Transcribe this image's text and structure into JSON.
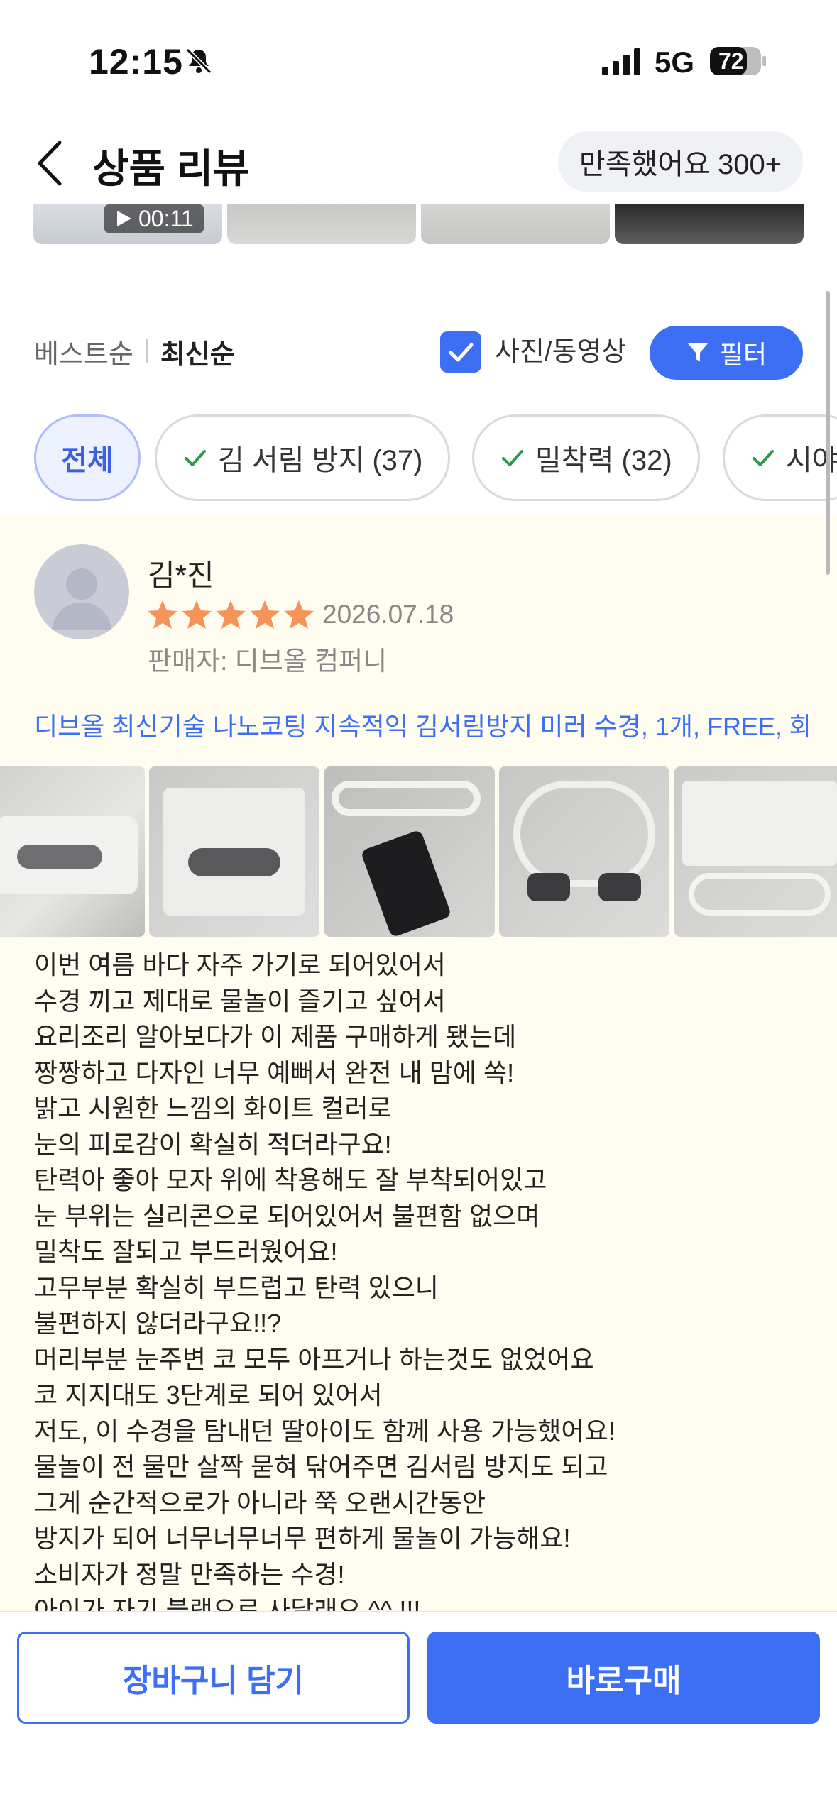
{
  "status_bar": {
    "time": "12:15",
    "network": "5G",
    "battery": "72"
  },
  "header": {
    "title": "상품 리뷰",
    "satisfaction_pill": "만족했어요 300+"
  },
  "top_thumbs": {
    "video_duration": "00:11"
  },
  "sort": {
    "best": "베스트순",
    "newest": "최신순",
    "photo_video_label": "사진/동영상",
    "filter_label": "필터"
  },
  "chips": [
    {
      "label": "전체"
    },
    {
      "label": "김 서림 방지 (37)"
    },
    {
      "label": "밀착력 (32)"
    },
    {
      "label": "시야"
    }
  ],
  "review": {
    "user": "김*진",
    "rating": 5,
    "date": "2026.07.18",
    "seller": "판매자: 디브올 컴퍼니",
    "product": "디브올 최신기술 나노코팅 지속적익 김서림방지 미러 수경, 1개, FREE, 화…",
    "body_lines": [
      "이번 여름 바다 자주 가기로 되어있어서",
      "수경 끼고 제대로 물놀이 즐기고 싶어서",
      "요리조리 알아보다가 이 제품 구매하게 됐는데",
      "짱짱하고 다자인 너무 예뻐서 완전 내 맘에 쏙!",
      "밝고 시원한 느낌의 화이트 컬러로",
      "눈의 피로감이 확실히 적더라구요!",
      "탄력아 좋아 모자 위에 착용해도 잘 부착되어있고",
      "눈 부위는 실리콘으로 되어있어서 불편함 없으며",
      "밀착도 잘되고 부드러웠어요!",
      "고무부분 확실히 부드럽고 탄력 있으니",
      "불편하지 않더라구요!!?",
      "머리부분 눈주변 코 모두 아프거나 하는것도 없었어요",
      "코 지지대도 3단계로 되어 있어서",
      "저도, 이 수경을 탐내던 딸아이도 함께 사용 가능했어요!",
      "물놀이 전 물만 살짝 묻혀 닦어주면 김서림 방지도 되고",
      "그게 순간적으로가 아니라 쭉 오랜시간동안",
      "방지가 되어 너무너무너무 편하게 물놀이 가능해요!",
      "소비자가 정말 만족하는 수경!",
      "아이가 자기 블랙으로 사달래요 ^^ !!!"
    ]
  },
  "bottom": {
    "cart": "장바구니 담기",
    "buy": "바로구매"
  },
  "colors": {
    "accent": "#3d6ff5",
    "star": "#f5945a",
    "review_bg": "#fffdf0"
  }
}
